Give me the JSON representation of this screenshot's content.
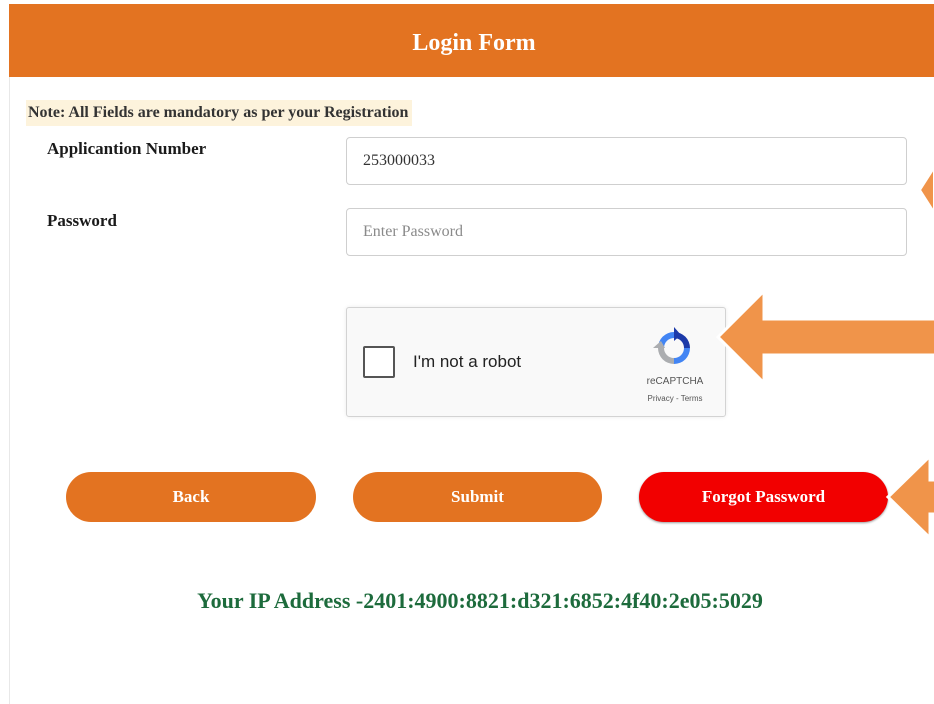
{
  "header": {
    "title": "Login Form"
  },
  "note": "Note: All Fields are mandatory as per your Registration",
  "form": {
    "application_number": {
      "label": "Applicantion Number",
      "value": "253000033"
    },
    "password": {
      "label": "Password",
      "value": "",
      "placeholder": "Enter Password"
    }
  },
  "captcha": {
    "label": "I'm not a robot",
    "brand": "reCAPTCHA",
    "links": "Privacy - Terms",
    "icon": "recaptcha-logo-icon"
  },
  "buttons": {
    "back": "Back",
    "submit": "Submit",
    "forgot": "Forgot Password"
  },
  "ip": {
    "label": "Your IP Address -",
    "value": "2401:4900:8821:d321:6852:4f40:2e05:5029"
  },
  "colors": {
    "header": "#e37321",
    "button": "#e37321",
    "forgot_button": "#f20000",
    "ip_text": "#1d6b3c",
    "arrow": "#f0944a"
  }
}
